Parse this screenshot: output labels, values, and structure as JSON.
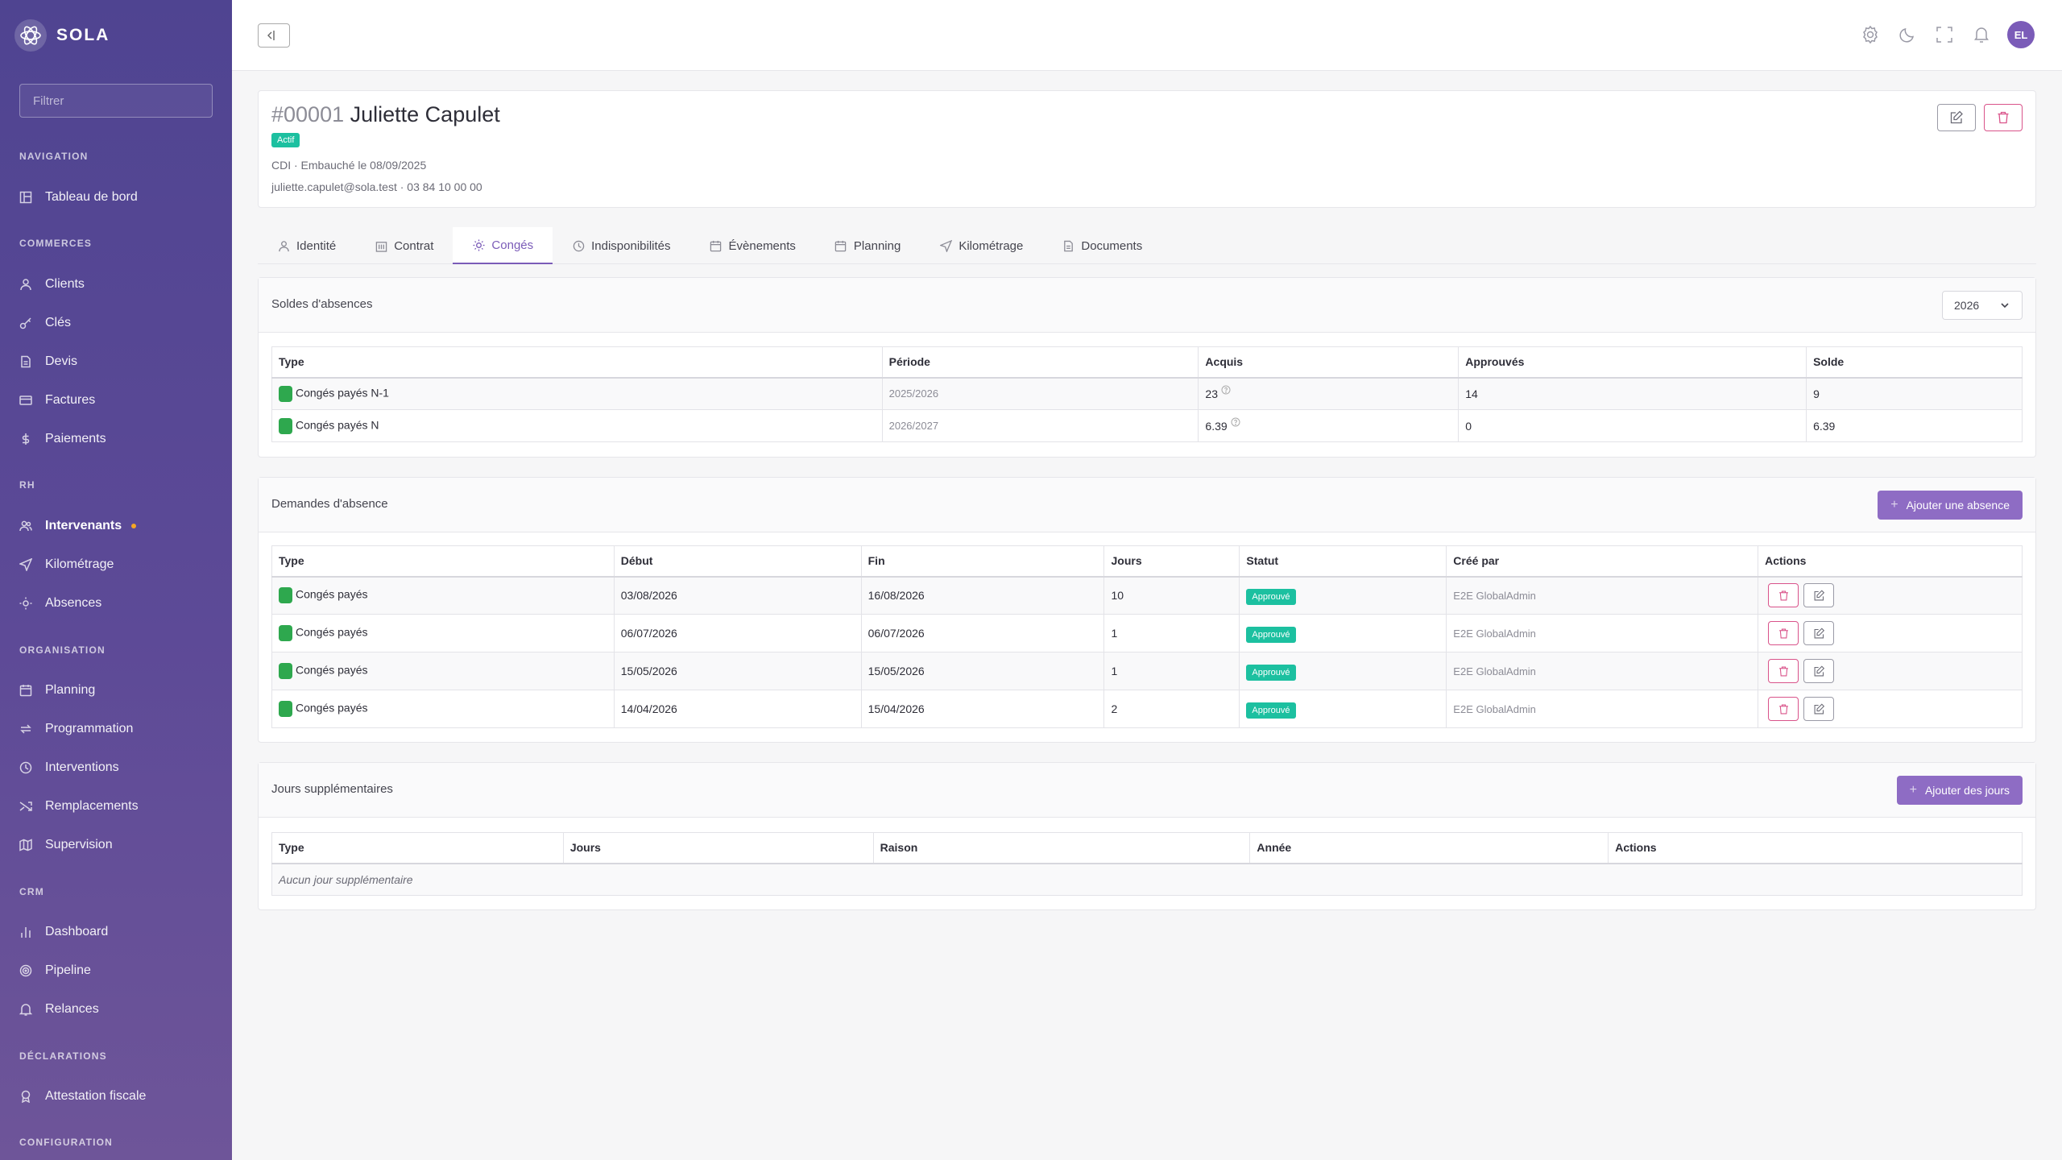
{
  "brand": {
    "name": "SOLA"
  },
  "sidebar": {
    "filter_placeholder": "Filtrer",
    "sections": {
      "navigation": "NAVIGATION",
      "commerces": "COMMERCES",
      "rh": "RH",
      "organisation": "ORGANISATION",
      "crm": "CRM",
      "declarations": "DÉCLARATIONS",
      "configuration": "CONFIGURATION"
    },
    "items": {
      "tableau": "Tableau de bord",
      "clients": "Clients",
      "cles": "Clés",
      "devis": "Devis",
      "factures": "Factures",
      "paiements": "Paiements",
      "intervenants": "Intervenants",
      "kilometrage": "Kilométrage",
      "absences": "Absences",
      "planning": "Planning",
      "programmation": "Programmation",
      "interventions": "Interventions",
      "remplacements": "Remplacements",
      "supervision": "Supervision",
      "dashboard": "Dashboard",
      "pipeline": "Pipeline",
      "relances": "Relances",
      "attestation": "Attestation fiscale"
    }
  },
  "header": {
    "avatar_initials": "EL"
  },
  "employee": {
    "id": "#00001",
    "name": "Juliette Capulet",
    "status": "Actif",
    "meta_line1": "CDI · Embauché le 08/09/2025",
    "meta_line2": "juliette.capulet@sola.test · 03 84 10 00 00"
  },
  "tabs": {
    "identite": "Identité",
    "contrat": "Contrat",
    "conges": "Congés",
    "indispo": "Indisponibilités",
    "evenements": "Évènements",
    "planning": "Planning",
    "kilometrage": "Kilométrage",
    "documents": "Documents"
  },
  "balances": {
    "title": "Soldes d'absences",
    "year": "2026",
    "headers": {
      "type": "Type",
      "periode": "Période",
      "acquis": "Acquis",
      "approuves": "Approuvés",
      "solde": "Solde"
    },
    "rows": [
      {
        "type": "Congés payés N-1",
        "periode": "2025/2026",
        "acquis": "23",
        "approuves": "14",
        "solde": "9"
      },
      {
        "type": "Congés payés N",
        "periode": "2026/2027",
        "acquis": "6.39",
        "approuves": "0",
        "solde": "6.39"
      }
    ]
  },
  "requests": {
    "title": "Demandes d'absence",
    "add_label": "Ajouter une absence",
    "headers": {
      "type": "Type",
      "debut": "Début",
      "fin": "Fin",
      "jours": "Jours",
      "statut": "Statut",
      "cree_par": "Créé par",
      "actions": "Actions"
    },
    "rows": [
      {
        "type": "Congés payés",
        "debut": "03/08/2026",
        "fin": "16/08/2026",
        "jours": "10",
        "statut": "Approuvé",
        "cree_par": "E2E GlobalAdmin"
      },
      {
        "type": "Congés payés",
        "debut": "06/07/2026",
        "fin": "06/07/2026",
        "jours": "1",
        "statut": "Approuvé",
        "cree_par": "E2E GlobalAdmin"
      },
      {
        "type": "Congés payés",
        "debut": "15/05/2026",
        "fin": "15/05/2026",
        "jours": "1",
        "statut": "Approuvé",
        "cree_par": "E2E GlobalAdmin"
      },
      {
        "type": "Congés payés",
        "debut": "14/04/2026",
        "fin": "15/04/2026",
        "jours": "2",
        "statut": "Approuvé",
        "cree_par": "E2E GlobalAdmin"
      }
    ]
  },
  "extra": {
    "title": "Jours supplémentaires",
    "add_label": "Ajouter des jours",
    "headers": {
      "type": "Type",
      "jours": "Jours",
      "raison": "Raison",
      "annee": "Année",
      "actions": "Actions"
    },
    "empty": "Aucun jour supplémentaire"
  },
  "colors": {
    "sidebar": "#54479a",
    "accent": "#7b5cb8",
    "primary_button": "#8e6cc4",
    "success": "#1cc0a0",
    "danger": "#d9538a",
    "type_green": "#2ea84e",
    "active_dot": "#f5a623"
  },
  "icons": {
    "sidebar": [
      "dashboard-icon",
      "user-icon",
      "key-icon",
      "file-icon",
      "card-icon",
      "dollar-icon",
      "users-icon",
      "send-icon",
      "sun-icon",
      "calendar-icon",
      "repeat-icon",
      "clock-icon",
      "shuffle-icon",
      "map-icon",
      "bar-chart-icon",
      "target-icon",
      "bell-icon",
      "award-icon"
    ],
    "header": [
      "gear-icon",
      "moon-icon",
      "fullscreen-icon",
      "bell-icon"
    ],
    "tabs": [
      "user-icon",
      "building-icon",
      "sun-icon",
      "clock-icon",
      "calendar-icon",
      "calendar-icon",
      "send-icon",
      "file-icon"
    ]
  }
}
